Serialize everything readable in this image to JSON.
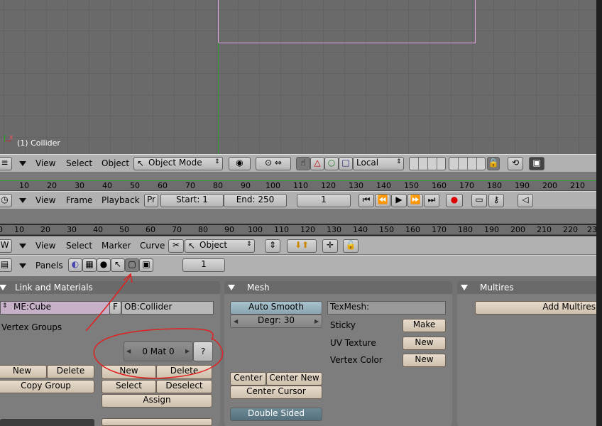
{
  "viewport": {
    "object_label": "(1) Collider",
    "axis_x": "x"
  },
  "header3d": {
    "view": "View",
    "select": "Select",
    "object": "Object",
    "mode": "Object Mode",
    "transform": "Local"
  },
  "ruler1": {
    "ticks": [
      "10",
      "20",
      "30",
      "40",
      "50",
      "60",
      "70",
      "80",
      "90",
      "100",
      "110",
      "120",
      "130",
      "140",
      "150",
      "160",
      "170",
      "180",
      "190",
      "200",
      "210"
    ]
  },
  "timeline": {
    "view": "View",
    "frame": "Frame",
    "playback": "Playback",
    "pr": "Pr",
    "start": "Start: 1",
    "end": "End: 250",
    "current": "1"
  },
  "ruler2": {
    "ticks": [
      "0",
      "10",
      "20",
      "30",
      "40",
      "50",
      "60",
      "70",
      "80",
      "90",
      "100",
      "110",
      "120",
      "130",
      "140",
      "150",
      "160",
      "170",
      "180",
      "190",
      "200",
      "210",
      "220",
      "23"
    ]
  },
  "ipo": {
    "view": "View",
    "select": "Select",
    "marker": "Marker",
    "curve": "Curve",
    "object": "Object"
  },
  "buttons": {
    "panels": "Panels",
    "page": "1"
  },
  "link_materials": {
    "title": "Link and Materials",
    "mesh": "ME:Cube",
    "f": "F",
    "object": "OB:Collider",
    "vertex_groups": "Vertex Groups",
    "new": "New",
    "delete": "Delete",
    "copy_group": "Copy Group",
    "mat": "0 Mat 0",
    "q": "?",
    "mat_new": "New",
    "mat_delete": "Delete",
    "select": "Select",
    "deselect": "Deselect",
    "assign": "Assign"
  },
  "mesh": {
    "title": "Mesh",
    "auto_smooth": "Auto Smooth",
    "degr": "Degr: 30",
    "texmesh": "TexMesh:",
    "sticky": "Sticky",
    "sticky_btn": "Make",
    "uv_texture": "UV Texture",
    "uv_btn": "New",
    "vertex_color": "Vertex Color",
    "vc_btn": "New",
    "center": "Center",
    "center_new": "Center New",
    "center_cursor": "Center Cursor",
    "double_sided": "Double Sided"
  },
  "multires": {
    "title": "Multires",
    "add": "Add Multires"
  },
  "colors": {
    "annotation": "#e02020"
  }
}
